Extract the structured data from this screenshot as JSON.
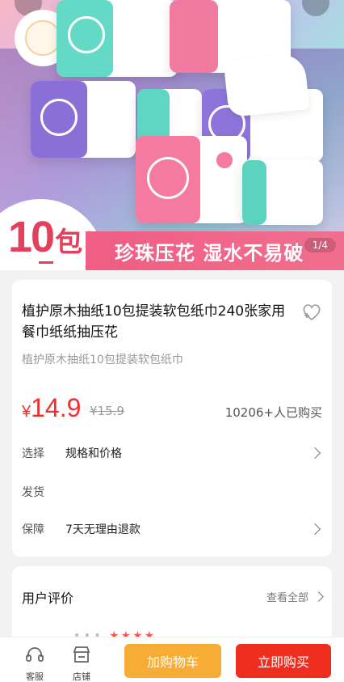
{
  "hero": {
    "badge_number": "10",
    "badge_unit": "包",
    "slogan": "珍珠压花 湿水不易破",
    "page_indicator": "1/4"
  },
  "product": {
    "title": "植护原木抽纸10包提装软包纸巾240张家用餐巾纸纸抽压花",
    "subtitle": "植护原木抽纸10包提装软包纸巾",
    "price_symbol": "¥",
    "price": "14.9",
    "original_price": "¥15.9",
    "sold": "10206+人已购买",
    "rows": [
      {
        "label": "选择",
        "value": "规格和价格"
      },
      {
        "label": "发货",
        "value": ""
      },
      {
        "label": "保障",
        "value": "7天无理由退款"
      }
    ]
  },
  "reviews": {
    "title": "用户评价",
    "view_all": "查看全部"
  },
  "bottom_bar": {
    "service_label": "客服",
    "shop_label": "店铺",
    "add_to_cart": "加购物车",
    "buy_now": "立即购买"
  },
  "colors": {
    "price_red": "#ef2e2e",
    "cart_orange": "#f6ac35",
    "buy_red": "#ee2e1e",
    "ribbon_pink": "#ef5d83"
  },
  "icons": [
    "heart-add-icon",
    "chevron-right-icon",
    "headset-icon",
    "store-icon",
    "star-icon"
  ]
}
